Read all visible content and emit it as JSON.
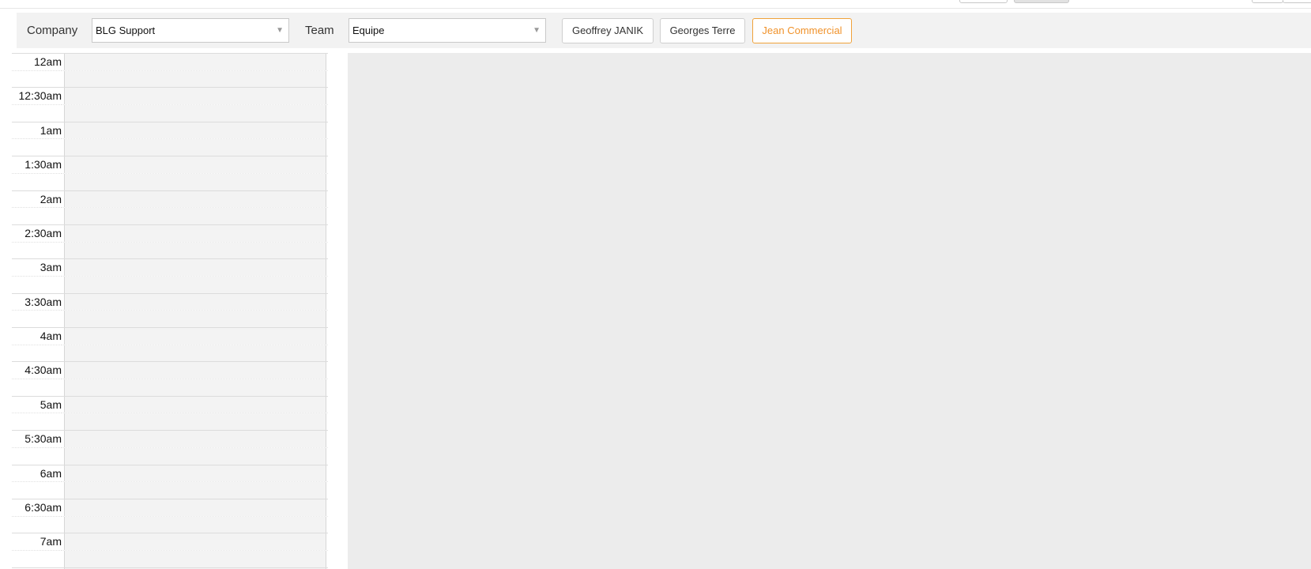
{
  "filters": {
    "company_label": "Company",
    "company_value": "BLG Support",
    "team_label": "Team",
    "team_value": "Equipe"
  },
  "people": [
    {
      "name": "Geoffrey JANIK",
      "active": false
    },
    {
      "name": "Georges Terre",
      "active": false
    },
    {
      "name": "Jean Commercial",
      "active": true
    }
  ],
  "calendar": {
    "times": [
      "12am",
      "12:30am",
      "1am",
      "1:30am",
      "2am",
      "2:30am",
      "3am",
      "3:30am",
      "4am",
      "4:30am",
      "5am",
      "5:30am",
      "6am",
      "6:30am",
      "7am"
    ]
  },
  "colors": {
    "accent": "#f0922a",
    "bar_bg": "#f2f2f2",
    "grid_bg": "#f3f3f3",
    "pane_bg": "#ececec"
  }
}
